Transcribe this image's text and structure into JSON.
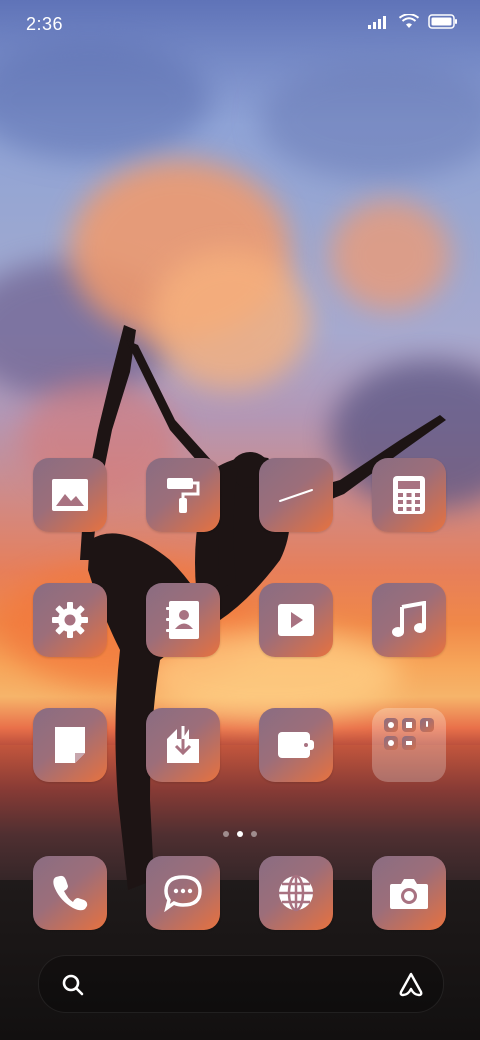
{
  "status_bar": {
    "time": "2:36",
    "icons": [
      "signal-icon",
      "wifi-icon",
      "battery-icon"
    ]
  },
  "wallpaper": {
    "subject": "sunset-silhouette"
  },
  "apps": [
    {
      "id": "gallery",
      "icon": "image-icon"
    },
    {
      "id": "themes",
      "icon": "paint-roller-icon"
    },
    {
      "id": "notes-pen",
      "icon": "pen-icon"
    },
    {
      "id": "calculator",
      "icon": "calculator-icon"
    },
    {
      "id": "settings",
      "icon": "gear-icon"
    },
    {
      "id": "contacts",
      "icon": "contacts-book-icon"
    },
    {
      "id": "video",
      "icon": "play-icon"
    },
    {
      "id": "music",
      "icon": "music-note-icon"
    },
    {
      "id": "notes",
      "icon": "note-icon"
    },
    {
      "id": "downloads",
      "icon": "download-icon"
    },
    {
      "id": "wallet",
      "icon": "wallet-icon"
    },
    {
      "id": "folder",
      "icon": "folder-icon"
    }
  ],
  "dock": [
    {
      "id": "phone",
      "icon": "phone-icon"
    },
    {
      "id": "messages",
      "icon": "message-icon"
    },
    {
      "id": "browser",
      "icon": "globe-icon"
    },
    {
      "id": "camera",
      "icon": "camera-icon"
    }
  ],
  "page_indicator": {
    "pages": 3,
    "current": 2
  },
  "search": {
    "left_icon": "search-icon",
    "right_icon": "assistant-icon"
  },
  "colors": {
    "icon_gradient_start": "#8a6d82",
    "icon_gradient_end": "#e8733f"
  }
}
